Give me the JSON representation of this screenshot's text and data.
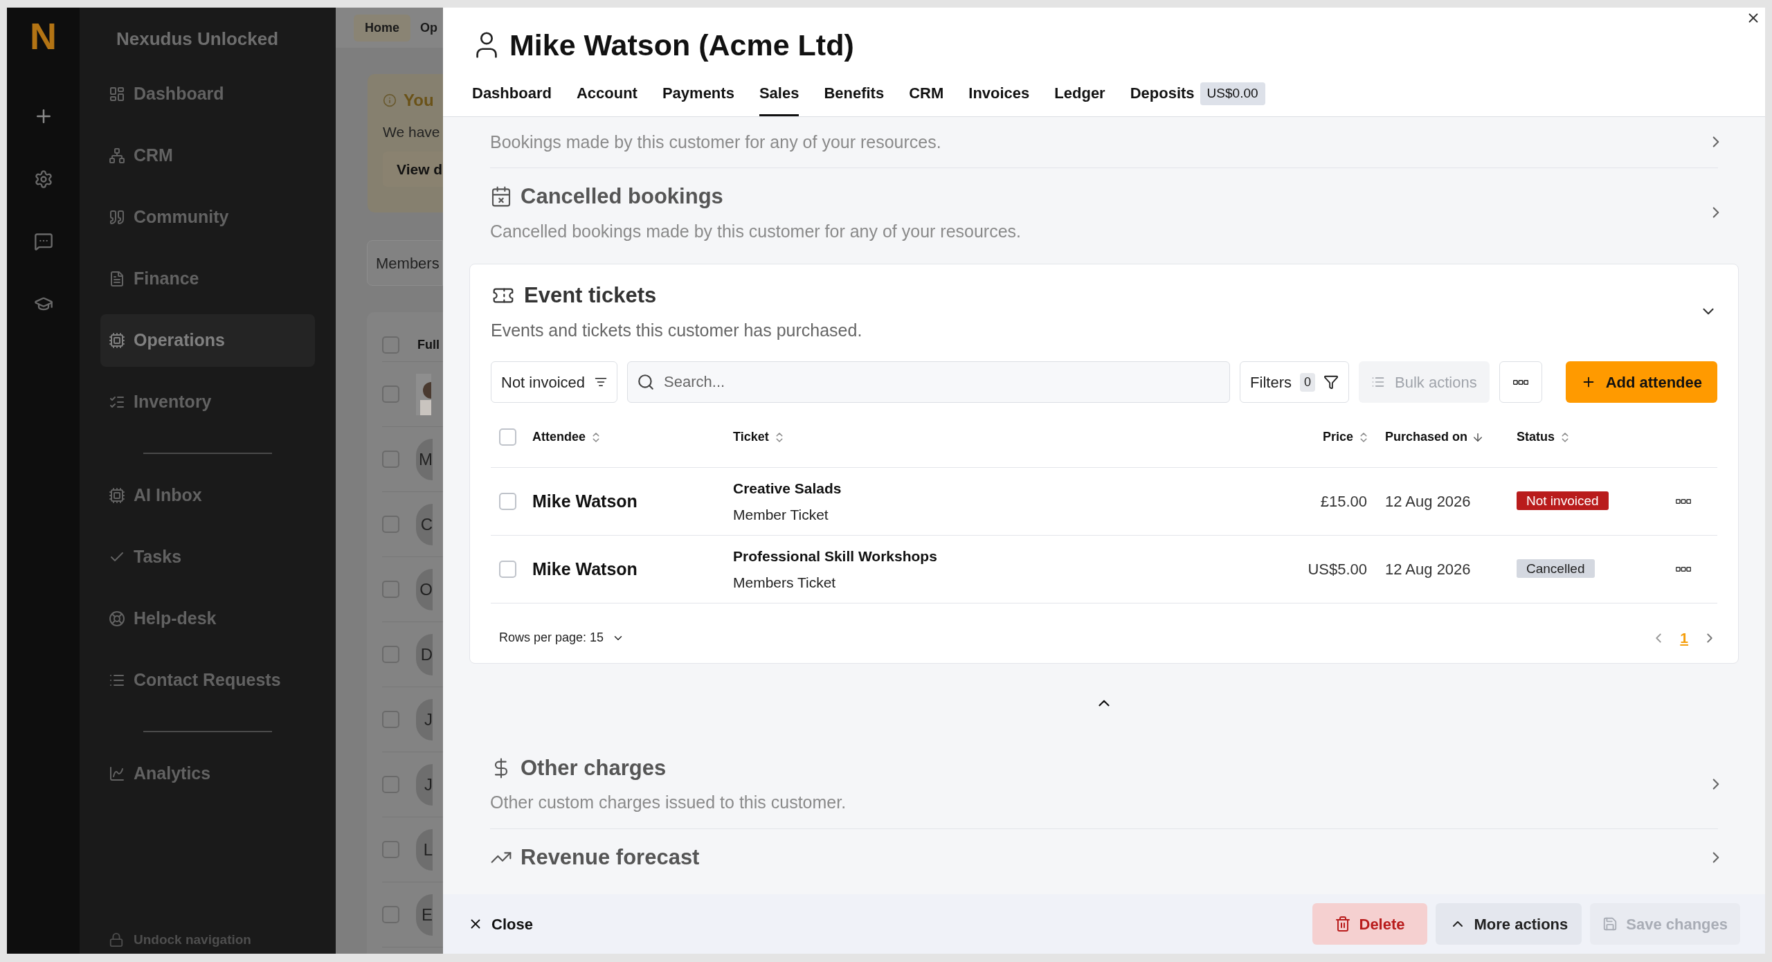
{
  "app": {
    "logo": "N",
    "workspace": "Nexudus Unlocked"
  },
  "nav_groups": [
    [
      {
        "label": "Dashboard",
        "selected": false
      },
      {
        "label": "CRM",
        "selected": false
      },
      {
        "label": "Community",
        "selected": false
      },
      {
        "label": "Finance",
        "selected": false
      },
      {
        "label": "Operations",
        "selected": true
      },
      {
        "label": "Inventory",
        "selected": false
      }
    ],
    [
      {
        "label": "AI Inbox",
        "selected": false
      },
      {
        "label": "Tasks",
        "selected": false
      },
      {
        "label": "Help-desk",
        "selected": false
      },
      {
        "label": "Contact Requests",
        "selected": false
      }
    ],
    [
      {
        "label": "Analytics",
        "selected": false
      }
    ]
  ],
  "undock": "Undock navigation",
  "background_page": {
    "breadcrumb": [
      "Home",
      "Op"
    ],
    "alert_title": "You",
    "alert_text": "We have",
    "alert_button": "View d",
    "tab": "Members",
    "column": "Full",
    "all_checked": false,
    "rows": [
      {
        "kind": "picture",
        "checked": false
      },
      {
        "initials": "M",
        "checked": false
      },
      {
        "initials": "C",
        "checked": false
      },
      {
        "initials": "O",
        "checked": false
      },
      {
        "initials": "D",
        "checked": false
      },
      {
        "initials": "J",
        "checked": false
      },
      {
        "initials": "J",
        "checked": false
      },
      {
        "initials": "L",
        "checked": false
      },
      {
        "initials": "E",
        "checked": false
      }
    ]
  },
  "panel": {
    "title": "Mike Watson (Acme Ltd)",
    "tabs": [
      {
        "label": "Dashboard",
        "selected": false
      },
      {
        "label": "Account",
        "selected": false
      },
      {
        "label": "Payments",
        "selected": false
      },
      {
        "label": "Sales",
        "selected": true
      },
      {
        "label": "Benefits",
        "selected": false
      },
      {
        "label": "CRM",
        "selected": false
      },
      {
        "label": "Invoices",
        "selected": false
      },
      {
        "label": "Ledger",
        "selected": false
      },
      {
        "label": "Deposits",
        "selected": false,
        "badge": "US$0.00"
      }
    ],
    "sections_above": [
      {
        "kind": "bookings",
        "description": "Bookings made by this customer for any of your resources."
      },
      {
        "kind": "cancelled",
        "title": "Cancelled bookings",
        "description": "Cancelled bookings made by this customer for any of your resources."
      }
    ],
    "event_tickets": {
      "title": "Event tickets",
      "description": "Events and tickets this customer has purchased.",
      "expanded": true,
      "status_filter": "Not invoiced",
      "search_placeholder": "Search...",
      "filters_label": "Filters",
      "filters_count": "0",
      "bulk_actions": {
        "label": "Bulk actions",
        "disabled": true
      },
      "add_button": "Add attendee",
      "all_checked": false,
      "columns": [
        {
          "label": "Attendee",
          "sorted": false
        },
        {
          "label": "Ticket",
          "sorted": false
        },
        {
          "label": "Price",
          "sorted": false
        },
        {
          "label": "Purchased on",
          "sorted": true
        },
        {
          "label": "Status",
          "sorted": false
        }
      ],
      "rows": [
        {
          "checked": false,
          "attendee": "Mike Watson",
          "ticket": "Creative Salads",
          "ticket_type": "Member Ticket",
          "price": "£15.00",
          "purchased_on": "12 Aug 2026",
          "status": {
            "label": "Not invoiced",
            "kind": "not_invoiced"
          }
        },
        {
          "checked": false,
          "attendee": "Mike Watson",
          "ticket": "Professional Skill Workshops",
          "ticket_type": "Members Ticket",
          "price": "US$5.00",
          "purchased_on": "12 Aug 2026",
          "status": {
            "label": "Cancelled",
            "kind": "cancelled"
          }
        }
      ],
      "rows_per_page": "Rows per page: 15",
      "pages": [
        {
          "label": "1",
          "selected": true
        }
      ]
    },
    "sections_below": [
      {
        "kind": "charges",
        "title": "Other charges",
        "description": "Other custom charges issued to this customer."
      },
      {
        "kind": "forecast",
        "title": "Revenue forecast"
      }
    ],
    "footer": {
      "close": "Close",
      "delete": "Delete",
      "more_actions": "More actions",
      "save": {
        "label": "Save changes",
        "disabled": true
      }
    }
  }
}
